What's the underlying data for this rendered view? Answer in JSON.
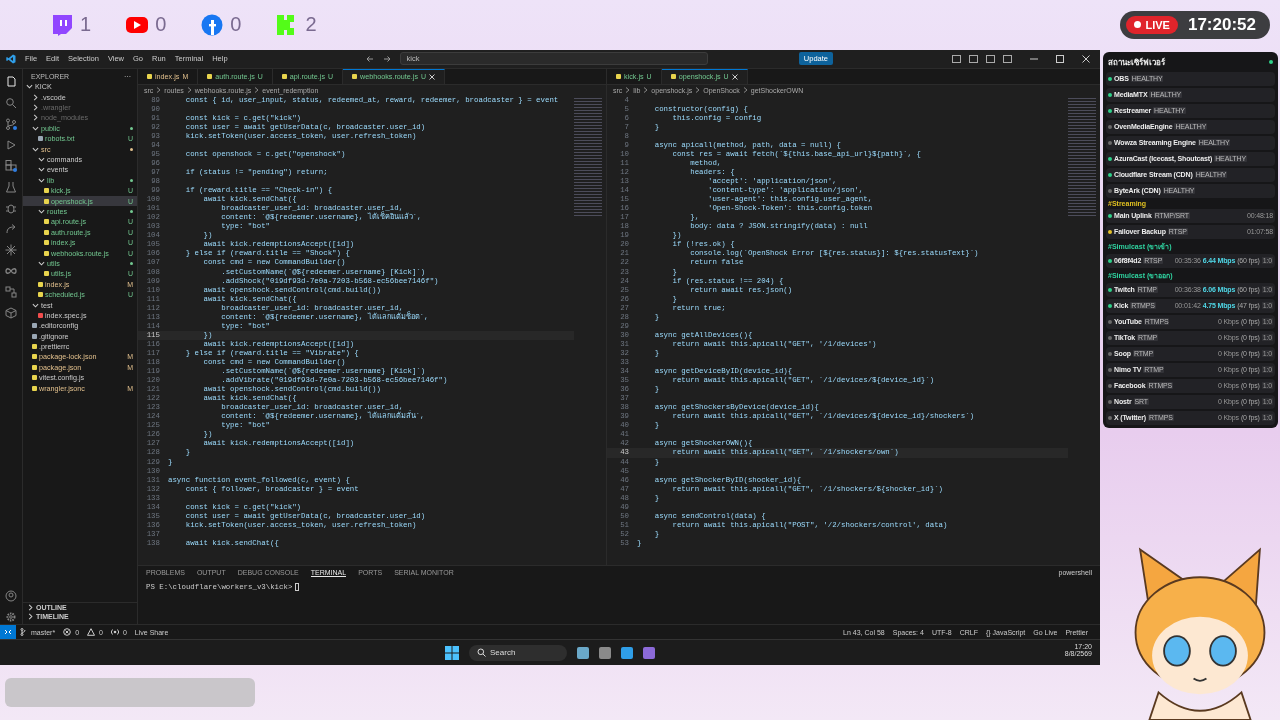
{
  "overlay": {
    "socials": [
      {
        "kind": "twitch",
        "count": "1"
      },
      {
        "kind": "youtube",
        "count": "0"
      },
      {
        "kind": "facebook",
        "count": "0"
      },
      {
        "kind": "kick",
        "count": "2"
      }
    ],
    "live_badge": "LIVE",
    "clock": "17:20:52"
  },
  "vscode": {
    "menu": [
      "File",
      "Edit",
      "Selection",
      "View",
      "Go",
      "Run",
      "Terminal",
      "Help"
    ],
    "command_center": "kick",
    "update_button": "Update",
    "activity_bar": [
      {
        "kind": "files",
        "selected": true,
        "badge": false
      },
      {
        "kind": "search",
        "selected": false,
        "badge": false
      },
      {
        "kind": "source-control",
        "selected": false,
        "badge": true
      },
      {
        "kind": "run",
        "selected": false,
        "badge": false
      },
      {
        "kind": "extensions",
        "selected": false,
        "badge": true
      },
      {
        "kind": "testing",
        "selected": false,
        "badge": false
      },
      {
        "kind": "bug",
        "selected": false,
        "badge": false
      },
      {
        "kind": "share",
        "selected": false,
        "badge": false
      },
      {
        "kind": "spark",
        "selected": false,
        "badge": false
      },
      {
        "kind": "infinity",
        "selected": false,
        "badge": false
      },
      {
        "kind": "nodes",
        "selected": false,
        "badge": false
      },
      {
        "kind": "box",
        "selected": false,
        "badge": false
      }
    ],
    "sidebar": {
      "title": "EXPLORER",
      "more": "···",
      "tree": [
        {
          "name": "KICK",
          "kind": "folder",
          "expanded": true,
          "selected": false,
          "untracked": false,
          "modified": false,
          "ignored": false,
          "has_changes": false,
          "children": [
            {
              "name": ".vscode",
              "kind": "folder",
              "expanded": false,
              "selected": false,
              "untracked": false,
              "modified": false,
              "ignored": false,
              "has_changes": false
            },
            {
              "name": ".wrangler",
              "kind": "folder",
              "expanded": false,
              "selected": false,
              "untracked": false,
              "modified": false,
              "ignored": true,
              "has_changes": false
            },
            {
              "name": "node_modules",
              "kind": "folder",
              "expanded": false,
              "selected": false,
              "untracked": false,
              "modified": false,
              "ignored": true,
              "has_changes": false
            },
            {
              "name": "public",
              "kind": "folder",
              "expanded": true,
              "selected": false,
              "untracked": true,
              "modified": false,
              "ignored": false,
              "has_changes": true,
              "children": [
                {
                  "name": "robots.txt",
                  "kind": "text",
                  "selected": false,
                  "untracked": true,
                  "modified": false,
                  "ignored": false,
                  "status": "U"
                }
              ]
            },
            {
              "name": "src",
              "kind": "folder",
              "expanded": true,
              "selected": false,
              "untracked": false,
              "modified": true,
              "ignored": false,
              "has_changes": true,
              "children": [
                {
                  "name": "commands",
                  "kind": "folder",
                  "expanded": true,
                  "selected": false,
                  "untracked": false,
                  "modified": false,
                  "ignored": false,
                  "has_changes": false
                },
                {
                  "name": "events",
                  "kind": "folder",
                  "expanded": true,
                  "selected": false,
                  "untracked": false,
                  "modified": false,
                  "ignored": false,
                  "has_changes": false
                },
                {
                  "name": "lib",
                  "kind": "folder",
                  "expanded": true,
                  "selected": false,
                  "untracked": true,
                  "modified": false,
                  "ignored": false,
                  "has_changes": true,
                  "children": [
                    {
                      "name": "kick.js",
                      "kind": "js",
                      "selected": false,
                      "untracked": true,
                      "modified": false,
                      "ignored": false,
                      "status": "U"
                    },
                    {
                      "name": "openshock.js",
                      "kind": "js",
                      "selected": true,
                      "untracked": true,
                      "modified": false,
                      "ignored": false,
                      "status": "U"
                    }
                  ]
                },
                {
                  "name": "routes",
                  "kind": "folder",
                  "expanded": true,
                  "selected": false,
                  "untracked": true,
                  "modified": false,
                  "ignored": false,
                  "has_changes": true,
                  "children": [
                    {
                      "name": "api.route.js",
                      "kind": "js",
                      "selected": false,
                      "untracked": true,
                      "modified": false,
                      "ignored": false,
                      "status": "U"
                    },
                    {
                      "name": "auth.route.js",
                      "kind": "js",
                      "selected": false,
                      "untracked": true,
                      "modified": false,
                      "ignored": false,
                      "status": "U"
                    },
                    {
                      "name": "index.js",
                      "kind": "js",
                      "selected": false,
                      "untracked": true,
                      "modified": false,
                      "ignored": false,
                      "status": "U"
                    },
                    {
                      "name": "webhooks.route.js",
                      "kind": "js",
                      "selected": false,
                      "untracked": true,
                      "modified": false,
                      "ignored": false,
                      "status": "U"
                    }
                  ]
                },
                {
                  "name": "utils",
                  "kind": "folder",
                  "expanded": true,
                  "selected": false,
                  "untracked": true,
                  "modified": false,
                  "ignored": false,
                  "has_changes": true,
                  "children": [
                    {
                      "name": "utils.js",
                      "kind": "js",
                      "selected": false,
                      "untracked": true,
                      "modified": false,
                      "ignored": false,
                      "status": "U"
                    }
                  ]
                },
                {
                  "name": "index.js",
                  "kind": "js",
                  "selected": false,
                  "untracked": false,
                  "modified": true,
                  "ignored": false,
                  "status": "M"
                },
                {
                  "name": "scheduled.js",
                  "kind": "js",
                  "selected": false,
                  "untracked": true,
                  "modified": false,
                  "ignored": false,
                  "status": "U"
                }
              ]
            },
            {
              "name": "test",
              "kind": "folder",
              "expanded": true,
              "selected": false,
              "untracked": false,
              "modified": false,
              "ignored": false,
              "has_changes": false,
              "children": [
                {
                  "name": "index.spec.js",
                  "kind": "test",
                  "selected": false,
                  "untracked": false,
                  "modified": false,
                  "ignored": false
                }
              ]
            },
            {
              "name": ".editorconfig",
              "kind": "config",
              "selected": false,
              "untracked": false,
              "modified": false,
              "ignored": false
            },
            {
              "name": ".gitignore",
              "kind": "config",
              "selected": false,
              "untracked": false,
              "modified": false,
              "ignored": false
            },
            {
              "name": ".prettierrc",
              "kind": "json",
              "selected": false,
              "untracked": false,
              "modified": false,
              "ignored": false
            },
            {
              "name": "package-lock.json",
              "kind": "json",
              "selected": false,
              "untracked": false,
              "modified": true,
              "ignored": false,
              "status": "M"
            },
            {
              "name": "package.json",
              "kind": "json",
              "selected": false,
              "untracked": false,
              "modified": true,
              "ignored": false,
              "status": "M"
            },
            {
              "name": "vitest.config.js",
              "kind": "js",
              "selected": false,
              "untracked": false,
              "modified": false,
              "ignored": false
            },
            {
              "name": "wrangler.jsonc",
              "kind": "json",
              "selected": false,
              "untracked": false,
              "modified": true,
              "ignored": false,
              "status": "M"
            }
          ]
        }
      ],
      "sections": [
        "OUTLINE",
        "TIMELINE"
      ]
    },
    "editors": [
      {
        "tabs": [
          {
            "label": "index.js",
            "status": "M",
            "modified": true,
            "selected": false
          },
          {
            "label": "auth.route.js",
            "status": "U",
            "modified": false,
            "selected": false
          },
          {
            "label": "api.route.js",
            "status": "U",
            "modified": false,
            "selected": false
          },
          {
            "label": "webhooks.route.js",
            "status": "U",
            "modified": false,
            "selected": true
          }
        ],
        "breadcrumb": [
          "src",
          "routes",
          "webhooks.route.js",
          "event_redemption"
        ],
        "lines": [
          {
            "num": "89",
            "code": "    const { id, user_input, status, redeemed_at, reward, redeemer, broadcaster } = event",
            "current": false
          },
          {
            "num": "90",
            "current": false
          },
          {
            "num": "91",
            "code": "    const kick = c.get(\"kick\")",
            "current": false
          },
          {
            "num": "92",
            "code": "    const user = await getUserData(c, broadcaster.user_id)",
            "current": false
          },
          {
            "num": "93",
            "code": "    kick.setToken(user.access_token, user.refresh_token)",
            "current": false
          },
          {
            "num": "94",
            "current": false
          },
          {
            "num": "95",
            "code": "    const openshock = c.get(\"openshock\")",
            "current": false
          },
          {
            "num": "96",
            "current": false
          },
          {
            "num": "97",
            "code": "    if (status != \"pending\") return;",
            "current": false
          },
          {
            "num": "98",
            "current": false
          },
          {
            "num": "99",
            "code": "    if (reward.title == \"Check-in\") {",
            "current": false
          },
          {
            "num": "100",
            "code": "        await kick.sendChat({",
            "current": false
          },
          {
            "num": "101",
            "code": "            broadcaster_user_id: broadcaster.user_id,",
            "current": false
          },
          {
            "num": "102",
            "code": "            content: `@${redeemer.username}, ได้เช็คอินแล้ว`,",
            "current": false
          },
          {
            "num": "103",
            "code": "            type: \"bot\"",
            "current": false
          },
          {
            "num": "104",
            "code": "        })",
            "current": false
          },
          {
            "num": "105",
            "code": "        await kick.redemptionsAccept([id])",
            "current": false
          },
          {
            "num": "106",
            "code": "    } else if (reward.title == \"Shock\") {",
            "current": false
          },
          {
            "num": "107",
            "code": "        const cmd = new CommandBuilder()",
            "current": false
          },
          {
            "num": "108",
            "code": "            .setCustomName(`@${redeemer.username} [Kick]`)",
            "current": false
          },
          {
            "num": "109",
            "code": "            .addShock(\"019df93d-7e0a-7203-b568-ec56bee7146f\")",
            "current": false
          },
          {
            "num": "110",
            "code": "        await openshock.sendControl(cmd.build())",
            "current": false
          },
          {
            "num": "111",
            "code": "        await kick.sendChat({",
            "current": false
          },
          {
            "num": "112",
            "code": "            broadcaster_user_id: broadcaster.user_id,",
            "current": false
          },
          {
            "num": "113",
            "code": "            content: `@${redeemer.username}, ได้แลกแต้มช็อต`,",
            "current": false
          },
          {
            "num": "114",
            "code": "            type: \"bot\"",
            "current": false
          },
          {
            "num": "115",
            "code": "        })",
            "current": true
          },
          {
            "num": "116",
            "code": "        await kick.redemptionsAccept([id])",
            "current": false
          },
          {
            "num": "117",
            "code": "    } else if (reward.title == \"Vibrate\") {",
            "current": false
          },
          {
            "num": "118",
            "code": "        const cmd = new CommandBuilder()",
            "current": false
          },
          {
            "num": "119",
            "code": "            .setCustomName(`@${redeemer.username} [Kick]`)",
            "current": false
          },
          {
            "num": "120",
            "code": "            .addVibrate(\"019df93d-7e0a-7203-b568-ec56bee7146f\")",
            "current": false
          },
          {
            "num": "121",
            "code": "        await openshock.sendControl(cmd.build())",
            "current": false
          },
          {
            "num": "122",
            "code": "        await kick.sendChat({",
            "current": false
          },
          {
            "num": "123",
            "code": "            broadcaster_user_id: broadcaster.user_id,",
            "current": false
          },
          {
            "num": "124",
            "code": "            content: `@${redeemer.username}, ได้แลกแต้มสั่น`,",
            "current": false
          },
          {
            "num": "125",
            "code": "            type: \"bot\"",
            "current": false
          },
          {
            "num": "126",
            "code": "        })",
            "current": false
          },
          {
            "num": "127",
            "code": "        await kick.redemptionsAccept([id])",
            "current": false
          },
          {
            "num": "128",
            "code": "    }",
            "current": false
          },
          {
            "num": "129",
            "code": "}",
            "current": false
          },
          {
            "num": "130",
            "current": false
          },
          {
            "num": "131",
            "code": "async function event_followed(c, event) {",
            "current": false
          },
          {
            "num": "132",
            "code": "    const { follower, broadcaster } = event",
            "current": false
          },
          {
            "num": "133",
            "current": false
          },
          {
            "num": "134",
            "code": "    const kick = c.get(\"kick\")",
            "current": false
          },
          {
            "num": "135",
            "code": "    const user = await getUserData(c, broadcaster.user_id)",
            "current": false
          },
          {
            "num": "136",
            "code": "    kick.setToken(user.access_token, user.refresh_token)",
            "current": false
          },
          {
            "num": "137",
            "current": false
          },
          {
            "num": "138",
            "code": "    await kick.sendChat({",
            "current": false
          }
        ]
      },
      {
        "tabs": [
          {
            "label": "kick.js",
            "status": "U",
            "modified": false,
            "selected": false
          },
          {
            "label": "openshock.js",
            "status": "U",
            "modified": false,
            "selected": true
          }
        ],
        "breadcrumb": [
          "src",
          "lib",
          "openshock.js",
          "OpenShock",
          "getShockerOWN"
        ],
        "lines": [
          {
            "num": "4",
            "current": false
          },
          {
            "num": "5",
            "code": "    constructor(config) {",
            "current": false
          },
          {
            "num": "6",
            "code": "        this.config = config",
            "current": false
          },
          {
            "num": "7",
            "code": "    }",
            "current": false
          },
          {
            "num": "8",
            "current": false
          },
          {
            "num": "9",
            "code": "    async apicall(method, path, data = null) {",
            "current": false
          },
          {
            "num": "10",
            "code": "        const res = await fetch(`${this.base_api_url}${path}`, {",
            "current": false
          },
          {
            "num": "11",
            "code": "            method,",
            "current": false
          },
          {
            "num": "12",
            "code": "            headers: {",
            "current": false
          },
          {
            "num": "13",
            "code": "                'accept': 'application/json',",
            "current": false
          },
          {
            "num": "14",
            "code": "                'content-type': 'application/json',",
            "current": false
          },
          {
            "num": "15",
            "code": "                'user-agent': this.config.user_agent,",
            "current": false
          },
          {
            "num": "16",
            "code": "                'Open-Shock-Token': this.config.token",
            "current": false
          },
          {
            "num": "17",
            "code": "            },",
            "current": false
          },
          {
            "num": "18",
            "code": "            body: data ? JSON.stringify(data) : null",
            "current": false
          },
          {
            "num": "19",
            "code": "        })",
            "current": false
          },
          {
            "num": "20",
            "code": "        if (!res.ok) {",
            "current": false
          },
          {
            "num": "21",
            "code": "            console.log(`OpenShock Error [${res.status}]: ${res.statusText}`)",
            "current": false
          },
          {
            "num": "22",
            "code": "            return false",
            "current": false
          },
          {
            "num": "23",
            "code": "        }",
            "current": false
          },
          {
            "num": "24",
            "code": "        if (res.status !== 204) {",
            "current": false
          },
          {
            "num": "25",
            "code": "            return await res.json()",
            "current": false
          },
          {
            "num": "26",
            "code": "        }",
            "current": false
          },
          {
            "num": "27",
            "code": "        return true;",
            "current": false
          },
          {
            "num": "28",
            "code": "    }",
            "current": false
          },
          {
            "num": "29",
            "current": false
          },
          {
            "num": "30",
            "code": "    async getAllDevices(){",
            "current": false
          },
          {
            "num": "31",
            "code": "        return await this.apicall(\"GET\", '/1/devices')",
            "current": false
          },
          {
            "num": "32",
            "code": "    }",
            "current": false
          },
          {
            "num": "33",
            "current": false
          },
          {
            "num": "34",
            "code": "    async getDeviceByID(device_id){",
            "current": false
          },
          {
            "num": "35",
            "code": "        return await this.apicall(\"GET\", `/1/devices/${device_id}`)",
            "current": false
          },
          {
            "num": "36",
            "code": "    }",
            "current": false
          },
          {
            "num": "37",
            "current": false
          },
          {
            "num": "38",
            "code": "    async getShockersByDevice(device_id){",
            "current": false
          },
          {
            "num": "39",
            "code": "        return await this.apicall(\"GET\", `/1/devices/${device_id}/shockers`)",
            "current": false
          },
          {
            "num": "40",
            "code": "    }",
            "current": false
          },
          {
            "num": "41",
            "current": false
          },
          {
            "num": "42",
            "code": "    async getShockerOWN(){",
            "current": false
          },
          {
            "num": "43",
            "code": "        return await this.apicall(\"GET\", `/1/shockers/own`)",
            "current": true
          },
          {
            "num": "44",
            "code": "    }",
            "current": false
          },
          {
            "num": "45",
            "current": false
          },
          {
            "num": "46",
            "code": "    async getShockerByID(shocker_id){",
            "current": false
          },
          {
            "num": "47",
            "code": "        return await this.apicall(\"GET\", `/1/shockers/${shocker_id}`)",
            "current": false
          },
          {
            "num": "48",
            "code": "    }",
            "current": false
          },
          {
            "num": "49",
            "current": false
          },
          {
            "num": "50",
            "code": "    async sendControl(data) {",
            "current": false
          },
          {
            "num": "51",
            "code": "        return await this.apicall(\"POST\", '/2/shockers/control', data)",
            "current": false
          },
          {
            "num": "52",
            "code": "    }",
            "current": false
          },
          {
            "num": "53",
            "code": "}",
            "current": false
          }
        ]
      }
    ],
    "panel": {
      "tabs": [
        {
          "label": "PROBLEMS",
          "selected": false
        },
        {
          "label": "OUTPUT",
          "selected": false
        },
        {
          "label": "DEBUG CONSOLE",
          "selected": false
        },
        {
          "label": "TERMINAL",
          "selected": true
        },
        {
          "label": "PORTS",
          "selected": false
        },
        {
          "label": "SERIAL MONITOR",
          "selected": false
        }
      ],
      "prompt": "PS E:\\cloudflare\\workers_v3\\kick>",
      "shell": "powershell"
    },
    "status_bar": {
      "branch": "master*",
      "errors": "0",
      "warnings": "0",
      "ports": "0",
      "live_share": "Live Share",
      "right": [
        "Ln 43, Col 58",
        "Spaces: 4",
        "UTF-8",
        "CRLF",
        "{} JavaScript",
        "Go Live",
        "Prettier"
      ]
    }
  },
  "taskbar": {
    "search": "Search",
    "time": "17:20",
    "date": "8/8/2569"
  },
  "stream_panel": {
    "title": "สถานะเซิร์ฟเวอร์",
    "online": true,
    "groups": [
      {
        "rows": [
          {
            "name": "OBS",
            "tag": "HEALTHY",
            "color": "#2fd08a"
          },
          {
            "name": "MediaMTX",
            "tag": "HEALTHY",
            "color": "#2fd08a"
          },
          {
            "name": "Restreamer",
            "tag": "HEALTHY",
            "color": "#2fd08a"
          },
          {
            "name": "OvenMediaEngine",
            "tag": "HEALTHY",
            "color": "#6b6b6b"
          },
          {
            "name": "Wowza Streaming Engine",
            "tag": "HEALTHY",
            "color": "#6b6b6b"
          },
          {
            "name": "AzuraCast (Icecast, Shoutcast)",
            "tag": "HEALTHY",
            "color": "#2fd08a"
          },
          {
            "name": "Cloudflare Stream (CDN)",
            "tag": "HEALTHY",
            "color": "#2fd08a"
          },
          {
            "name": "ByteArk (CDN)",
            "tag": "HEALTHY",
            "color": "#6b6b6b"
          }
        ]
      },
      {
        "heading": "#Streaming",
        "color": "#e0c020",
        "rows": [
          {
            "name": "Main Uplink",
            "tag": "RTMP/SRT",
            "color": "#2fd08a",
            "uptime": "00:48:18"
          },
          {
            "name": "Failover Backup",
            "tag": "RTSP",
            "color": "#e6c229",
            "uptime": "01:07:58"
          }
        ]
      },
      {
        "heading": "#Simulcast (ขาเข้า)",
        "color": "#2fd3a0",
        "rows": [
          {
            "name": "06f8f4d2",
            "tag": "RTSP",
            "color": "#2fd08a",
            "uptime": "00:35:36",
            "bitrate": "6.44 Mbps",
            "fps": "(60 fps)",
            "ratio": "1:0",
            "live": true
          }
        ]
      },
      {
        "heading": "#Simulcast (ขาออก)",
        "color": "#2fd3a0",
        "rows": [
          {
            "name": "Twitch",
            "tag": "RTMP",
            "color": "#2fd08a",
            "uptime": "00:36:38",
            "bitrate": "6.06 Mbps",
            "fps": "(60 fps)",
            "ratio": "1:0",
            "live": true
          },
          {
            "name": "Kick",
            "tag": "RTMPS",
            "color": "#2fd08a",
            "uptime": "00:01:42",
            "bitrate": "4.75 Mbps",
            "fps": "(47 fps)",
            "ratio": "1:0",
            "live": true
          },
          {
            "name": "YouTube",
            "tag": "RTMPS",
            "color": "#6b6b6b",
            "bitrate": "0 Kbps",
            "fps": "(0 fps)",
            "ratio": "1:0",
            "live": false
          },
          {
            "name": "TikTok",
            "tag": "RTMP",
            "color": "#6b6b6b",
            "bitrate": "0 Kbps",
            "fps": "(0 fps)",
            "ratio": "1:0",
            "live": false
          },
          {
            "name": "Soop",
            "tag": "RTMP",
            "color": "#6b6b6b",
            "bitrate": "0 Kbps",
            "fps": "(0 fps)",
            "ratio": "1:0",
            "live": false
          },
          {
            "name": "Nimo TV",
            "tag": "RTMP",
            "color": "#6b6b6b",
            "bitrate": "0 Kbps",
            "fps": "(0 fps)",
            "ratio": "1:0",
            "live": false
          },
          {
            "name": "Facebook",
            "tag": "RTMPS",
            "color": "#6b6b6b",
            "bitrate": "0 Kbps",
            "fps": "(0 fps)",
            "ratio": "1:0",
            "live": false
          },
          {
            "name": "Nostr",
            "tag": "SRT",
            "color": "#6b6b6b",
            "bitrate": "0 Kbps",
            "fps": "(0 fps)",
            "ratio": "1:0",
            "live": false
          },
          {
            "name": "X (Twitter)",
            "tag": "RTMPS",
            "color": "#6b6b6b",
            "bitrate": "0 Kbps",
            "fps": "(0 fps)",
            "ratio": "1:0",
            "live": false
          }
        ]
      }
    ]
  }
}
